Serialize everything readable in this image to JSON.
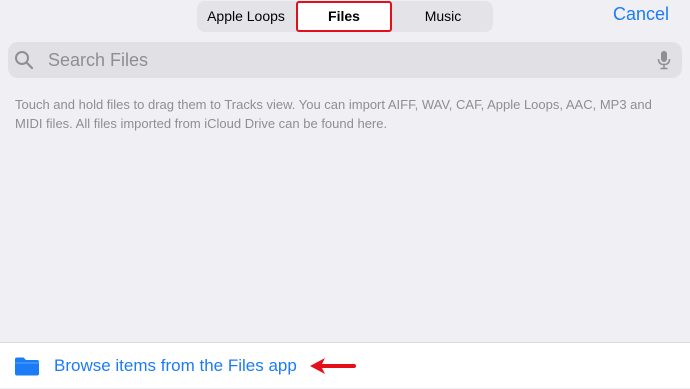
{
  "tabs": {
    "apple_loops": "Apple Loops",
    "files": "Files",
    "music": "Music",
    "selected": "Files"
  },
  "cancel_label": "Cancel",
  "search": {
    "placeholder": "Search Files",
    "value": ""
  },
  "info_text": "Touch and hold files to drag them to Tracks view. You can import AIFF, WAV, CAF, Apple Loops, AAC, MP3 and MIDI files. All files imported from iCloud Drive can be found here.",
  "browse_label": "Browse items from the Files app",
  "icons": {
    "search": "search-icon",
    "mic": "mic-icon",
    "folder": "folder-icon",
    "annotation": "red-arrow-icon"
  },
  "colors": {
    "accent": "#1c7cf5",
    "highlight": "#e3101c",
    "background": "#efeff4"
  }
}
